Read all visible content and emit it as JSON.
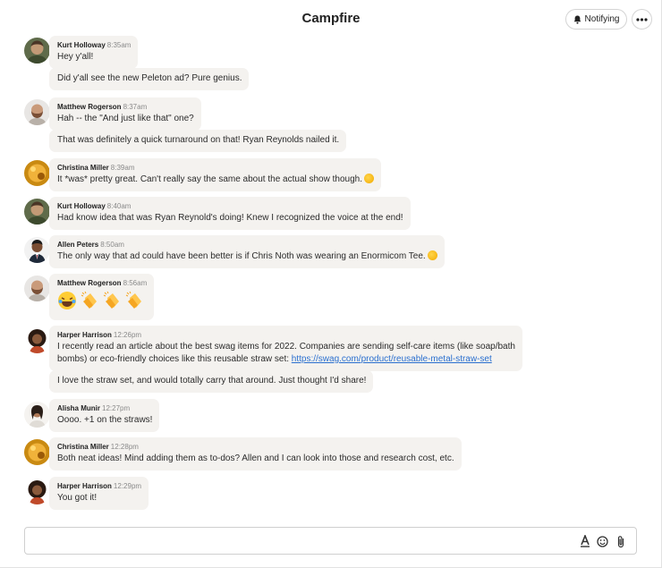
{
  "header": {
    "title": "Campfire",
    "notify_label": "Notifying"
  },
  "messages": [
    {
      "author": "Kurt Holloway",
      "time": "8:35am",
      "text": "Hey y'all!",
      "avatar": "kurt"
    },
    {
      "text": "Did y'all see the new Peleton ad? Pure genius."
    },
    {
      "author": "Matthew Rogerson",
      "time": "8:37am",
      "text": "Hah -- the \"And just like that\" one?",
      "avatar": "matthew"
    },
    {
      "text": "That was definitely a quick turnaround on that! Ryan Reynolds nailed it."
    },
    {
      "author": "Christina Miller",
      "time": "8:39am",
      "text": "It *was* pretty great. Can't really say the same about the actual show though.",
      "emoji": "drooling-face",
      "avatar": "christina"
    },
    {
      "author": "Kurt Holloway",
      "time": "8:40am",
      "text": "Had know idea that was Ryan Reynold's doing! Knew I recognized the voice at the end!",
      "avatar": "kurt"
    },
    {
      "author": "Allen Peters",
      "time": "8:50am",
      "text": "The only way that ad could have been better is if Chris Noth was wearing an Enormicom Tee.",
      "emoji": "laughing-crying-face",
      "avatar": "allen"
    },
    {
      "author": "Matthew Rogerson",
      "time": "8:56am",
      "emojis": [
        "laughing-crying-face",
        "clapping-hands",
        "clapping-hands",
        "clapping-hands"
      ],
      "avatar": "matthew"
    },
    {
      "author": "Harper Harrison",
      "time": "12:26pm",
      "text_line1": "I recently read an article about the best swag items for 2022. Companies are sending self-care items (like soap/bath",
      "text_line2": "bombs) or eco-friendly choices like this reusable straw set:",
      "link": "https://swag.com/product/reusable-metal-straw-set",
      "avatar": "harper"
    },
    {
      "text": "I love the straw set, and would totally carry that around. Just thought I'd share!"
    },
    {
      "author": "Alisha Munir",
      "time": "12:27pm",
      "text": "Oooo. +1 on the straws!",
      "avatar": "alisha"
    },
    {
      "author": "Christina Miller",
      "time": "12:28pm",
      "text": "Both neat ideas! Mind adding them as to-dos? Allen and I can look into those and research cost, etc.",
      "avatar": "christina"
    },
    {
      "author": "Harper Harrison",
      "time": "12:29pm",
      "text": "You got it!",
      "avatar": "harper"
    }
  ],
  "composer": {
    "placeholder": "",
    "tools": [
      "text-format-icon",
      "emoji-icon",
      "attachment-icon"
    ]
  },
  "colors": {
    "bubble": "#f4f2ef",
    "link": "#2a6fcf",
    "border": "#d4d4d4"
  }
}
